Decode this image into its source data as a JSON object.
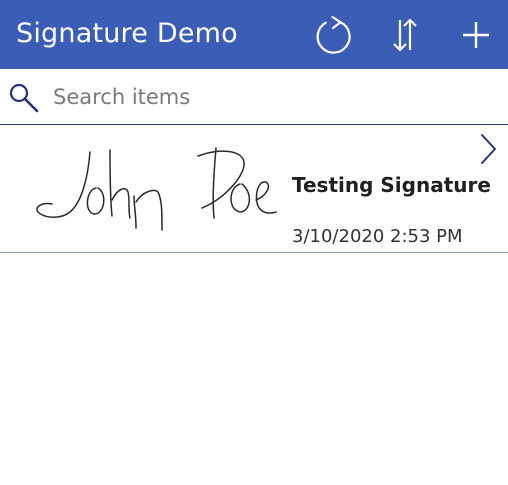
{
  "header": {
    "title": "Signature Demo",
    "background_color": "#3b5db6",
    "icons": {
      "refresh": "refresh-icon",
      "sort": "sort-icon",
      "add": "add-icon"
    }
  },
  "search": {
    "placeholder": "Search items",
    "value": "",
    "icon": "search-icon"
  },
  "items": [
    {
      "signature_image": "handwritten signature",
      "title": "Testing Signature",
      "date": "3/10/2020 2:53 PM",
      "icon": "chevron-right-icon"
    }
  ],
  "colors": {
    "accent": "#3b5db6",
    "divider": "#24337a"
  }
}
